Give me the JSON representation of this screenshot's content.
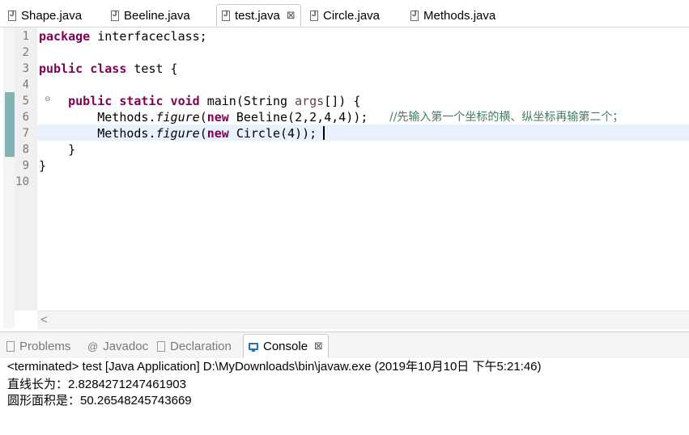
{
  "editor_tabs": [
    {
      "label": "Shape.java",
      "active": false
    },
    {
      "label": "Beeline.java",
      "active": false
    },
    {
      "label": "test.java",
      "active": true
    },
    {
      "label": "Circle.java",
      "active": false
    },
    {
      "label": "Methods.java",
      "active": false
    }
  ],
  "editor": {
    "line_numbers": [
      "1",
      "2",
      "3",
      "4",
      "5",
      "6",
      "7",
      "8",
      "9",
      "10"
    ],
    "code": {
      "l1_kw": "package",
      "l1_rest": " interfaceclass;",
      "l3_kw": "public class",
      "l3_rest": " test {",
      "l5_indent": "    ",
      "l5_kw": "public static void",
      "l5_mid": " main(String ",
      "l5_param": "args",
      "l5_end": "[]) {",
      "l6_indent": "        ",
      "l6_a": "Methods.",
      "l6_method": "figure",
      "l6_b": "(",
      "l6_new": "new",
      "l6_c": " Beeline(2,2,4,4));",
      "l6_comment": "//先输入第一个坐标的横、纵坐标再输第二个；",
      "l7_indent": "        ",
      "l7_a": "Methods.",
      "l7_method": "figure",
      "l7_b": "(",
      "l7_new": "new",
      "l7_c": " Circle(4));",
      "l8": "    }",
      "l9": "}"
    },
    "fold_marker": "⊖",
    "scroll_left_arrow": "<"
  },
  "view_tabs": [
    {
      "label": "Problems",
      "icon": "problems-icon"
    },
    {
      "label": "Javadoc",
      "icon": "javadoc-icon",
      "glyph": "@"
    },
    {
      "label": "Declaration",
      "icon": "declaration-icon"
    },
    {
      "label": "Console",
      "icon": "console-icon",
      "active": true
    }
  ],
  "close_glyph": "⊠",
  "console": {
    "header": "<terminated> test [Java Application] D:\\MyDownloads\\bin\\javaw.exe (2019年10月10日 下午5:21:46)",
    "lines": [
      "直线长为：2.8284271247461903",
      "圆形面积是：50.26548245743669"
    ]
  },
  "colors": {
    "keyword": "#7f0055",
    "comment": "#3f7f5f",
    "parameter": "#6a3e3e",
    "current_line": "#e8f2fe",
    "console_icon": "#2a6fb5"
  }
}
